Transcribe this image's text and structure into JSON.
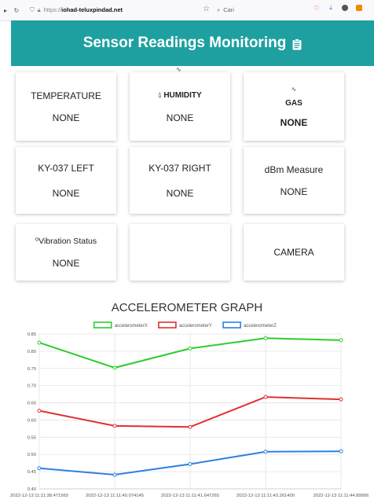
{
  "browser": {
    "url_protocol": "https://",
    "url_host": "iohad-teluxpindad.net",
    "search_placeholder": "Cari"
  },
  "header": {
    "title": "Sensor Readings Monitoring"
  },
  "cards": [
    {
      "title": "TEMPERATURE",
      "value": "NONE"
    },
    {
      "title": "HUMIDITY",
      "value": "NONE"
    },
    {
      "title": "GAS",
      "value": "NONE"
    },
    {
      "title": "KY-037 LEFT",
      "value": "NONE"
    },
    {
      "title": "KY-037 RIGHT",
      "value": "NONE"
    },
    {
      "title": "dBm Measure",
      "value": "NONE"
    },
    {
      "title": "Vibration Status",
      "value": "NONE"
    },
    {
      "title": "",
      "value": ""
    },
    {
      "title": "CAMERA",
      "value": ""
    }
  ],
  "chart_data": {
    "type": "line",
    "title": "ACCELEROMETER GRAPH",
    "x": [
      "2022-12-13 11:11:38.471565",
      "2022-12-13 11:11:40.074145",
      "2022-12-13 11:11:41.647265",
      "2022-12-13 11:11:43.261400",
      "2022-12-13 11:11:44.89956"
    ],
    "series": [
      {
        "name": "accelerometerX",
        "color": "#2ecc2e",
        "values": [
          0.825,
          0.752,
          0.808,
          0.838,
          0.832
        ]
      },
      {
        "name": "accelerometerY",
        "color": "#e03030",
        "values": [
          0.627,
          0.583,
          0.58,
          0.667,
          0.66
        ]
      },
      {
        "name": "accelerometerZ",
        "color": "#2f7fe0",
        "values": [
          0.46,
          0.441,
          0.472,
          0.508,
          0.509
        ]
      }
    ],
    "ylim": [
      0.4,
      0.85
    ],
    "yticks": [
      "0.85",
      "0.80",
      "0.75",
      "0.70",
      "0.65",
      "0.60",
      "0.55",
      "0.50",
      "0.45",
      "0.40"
    ],
    "grid": true,
    "legend_position": "top"
  }
}
